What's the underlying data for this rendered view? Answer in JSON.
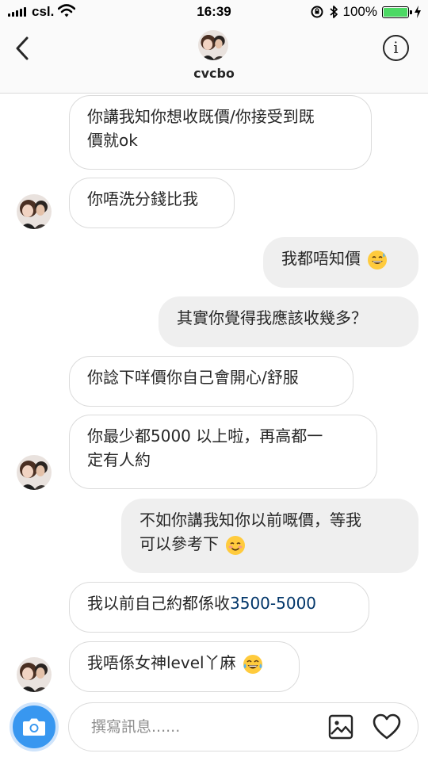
{
  "status_bar": {
    "carrier": "csl.",
    "time": "16:39",
    "battery_percent": "100%",
    "battery_level": 1.0,
    "icons": [
      "signal-bars-icon",
      "wifi-icon",
      "orientation-lock-icon",
      "bluetooth-icon",
      "battery-icon",
      "charging-bolt-icon"
    ]
  },
  "header": {
    "username": "cvcbo",
    "back_icon": "chevron-left-icon",
    "info_icon": "info-icon",
    "info_glyph": "i"
  },
  "messages": [
    {
      "direction": "incoming",
      "lines": [
        "你講我知你想收既價/你接受到既",
        "價就ok"
      ],
      "avatar": false
    },
    {
      "direction": "incoming",
      "lines": [
        "你唔洗分錢比我"
      ],
      "avatar": true
    },
    {
      "direction": "outgoing",
      "lines": [
        "我都唔知價"
      ],
      "emoji": "grinning-sweat-emoji"
    },
    {
      "direction": "outgoing",
      "lines": [
        "其實你覺得我應該收幾多？"
      ]
    },
    {
      "direction": "incoming",
      "lines": [
        "你諗下咩價你自己會開心/舒服"
      ],
      "avatar": false
    },
    {
      "direction": "incoming",
      "lines": [
        "你最少都5000 以上啦，再高都一",
        "定有人約"
      ],
      "avatar": true
    },
    {
      "direction": "outgoing",
      "lines": [
        "不如你講我知你以前嘅價，等我",
        "可以參考下"
      ],
      "emoji": "smiling-blush-emoji"
    },
    {
      "direction": "incoming",
      "text_prefix": "我以前自己約都係收",
      "text_link": "3500-5000",
      "avatar": false
    },
    {
      "direction": "incoming",
      "lines": [
        "我唔係女神level丫麻"
      ],
      "emoji": "tears-of-joy-emoji",
      "avatar": true
    }
  ],
  "composer": {
    "placeholder": "撰寫訊息......",
    "camera_icon": "camera-icon",
    "gallery_icon": "gallery-icon",
    "heart_icon": "heart-icon"
  },
  "colors": {
    "accent_blue": "#3897f0",
    "link_blue": "#003569",
    "incoming_border": "#dbdbdb",
    "outgoing_bg": "#efefef",
    "battery_green": "#4cd964"
  }
}
